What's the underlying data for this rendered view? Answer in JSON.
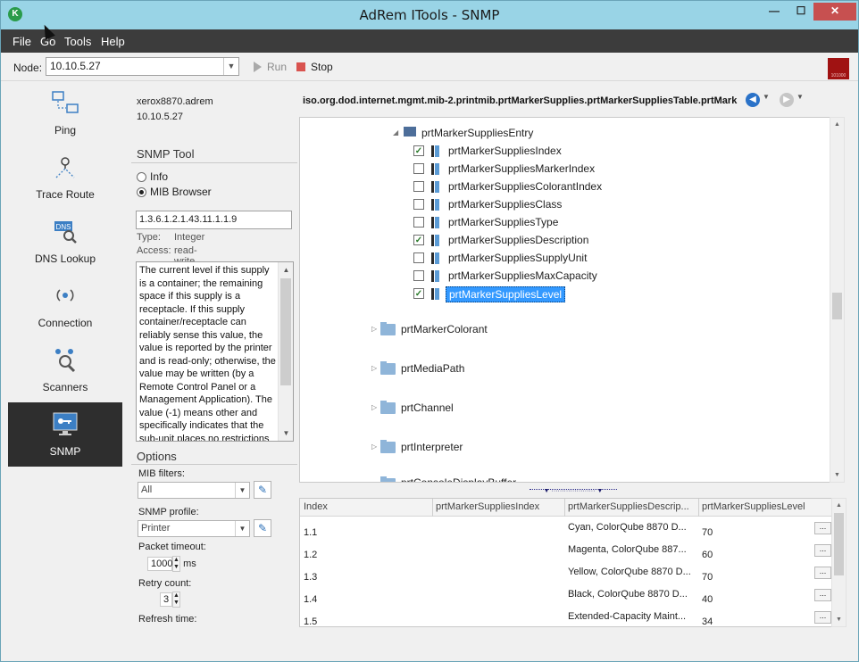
{
  "window": {
    "title": "AdRem ITools - SNMP",
    "app_icon": "K"
  },
  "menu": [
    "File",
    "Go",
    "Tools",
    "Help"
  ],
  "toolbar": {
    "node_label": "Node:",
    "node_value": "10.10.5.27",
    "run_label": "Run",
    "stop_label": "Stop",
    "brand_text": "101000"
  },
  "nav": [
    {
      "label": "Ping",
      "icon": "ping-icon"
    },
    {
      "label": "Trace Route",
      "icon": "trace-route-icon"
    },
    {
      "label": "DNS Lookup",
      "icon": "dns-lookup-icon",
      "badge": "DNS"
    },
    {
      "label": "Connection",
      "icon": "connection-icon"
    },
    {
      "label": "Scanners",
      "icon": "scanners-icon"
    },
    {
      "label": "SNMP",
      "icon": "snmp-icon"
    }
  ],
  "device": {
    "hostname": "xerox8870.adrem",
    "ip": "10.10.5.27"
  },
  "snmp_tool": {
    "heading": "SNMP Tool",
    "radio_info": "Info",
    "radio_mib": "MIB Browser",
    "oid": "1.3.6.1.2.1.43.11.1.1.9",
    "type_label": "Type:",
    "type_value": "Integer",
    "access_label": "Access:",
    "access_value": "read-write",
    "description": "The current level if this supply is a container; the remaining space if this supply is a receptacle. If this supply container/receptacle can reliably sense this value, the value is reported by the printer and is read-only; otherwise, the value may be written (by a Remote Control Panel or a Management Application). The value (-1) means other and specifically indicates that the sub-unit places no restrictions on this"
  },
  "options": {
    "heading": "Options",
    "mib_filters_label": "MIB filters:",
    "mib_filters_value": "All",
    "snmp_profile_label": "SNMP profile:",
    "snmp_profile_value": "Printer",
    "packet_timeout_label": "Packet timeout:",
    "packet_timeout_value": "1000",
    "packet_timeout_unit": "ms",
    "retry_label": "Retry count:",
    "retry_value": "3",
    "refresh_label": "Refresh time:"
  },
  "browser": {
    "path": "iso.org.dod.internet.mgmt.mib-2.printmib.prtMarkerSupplies.prtMarkerSuppliesTable.prtMark",
    "entry_node": "prtMarkerSuppliesEntry",
    "leaves": [
      {
        "label": "prtMarkerSuppliesIndex",
        "checked": true
      },
      {
        "label": "prtMarkerSuppliesMarkerIndex",
        "checked": false
      },
      {
        "label": "prtMarkerSuppliesColorantIndex",
        "checked": false
      },
      {
        "label": "prtMarkerSuppliesClass",
        "checked": false
      },
      {
        "label": "prtMarkerSuppliesType",
        "checked": false
      },
      {
        "label": "prtMarkerSuppliesDescription",
        "checked": true
      },
      {
        "label": "prtMarkerSuppliesSupplyUnit",
        "checked": false
      },
      {
        "label": "prtMarkerSuppliesMaxCapacity",
        "checked": false
      },
      {
        "label": "prtMarkerSuppliesLevel",
        "checked": true,
        "selected": true
      }
    ],
    "folders": [
      "prtMarkerColorant",
      "prtMediaPath",
      "prtChannel",
      "prtInterpreter",
      "prtConsoleDisplayBuffer"
    ]
  },
  "grid": {
    "columns": [
      "Index",
      "prtMarkerSuppliesIndex",
      "prtMarkerSuppliesDescrip...",
      "prtMarkerSuppliesLevel"
    ],
    "rows": [
      {
        "index": "1.1",
        "supplies_index": "",
        "description": "Cyan, ColorQube 8870 D...",
        "level": "70"
      },
      {
        "index": "1.2",
        "supplies_index": "",
        "description": "Magenta, ColorQube 887...",
        "level": "60"
      },
      {
        "index": "1.3",
        "supplies_index": "",
        "description": "Yellow, ColorQube 8870 D...",
        "level": "70"
      },
      {
        "index": "1.4",
        "supplies_index": "",
        "description": "Black, ColorQube 8870 D...",
        "level": "40"
      },
      {
        "index": "1.5",
        "supplies_index": "",
        "description": "Extended-Capacity Maint...",
        "level": "34"
      }
    ],
    "more_label": "..."
  },
  "colors": {
    "titlebar": "#99d4e6",
    "menubar": "#3c3c3c",
    "accent": "#3399ff",
    "nav_active": "#2e2e2e"
  }
}
